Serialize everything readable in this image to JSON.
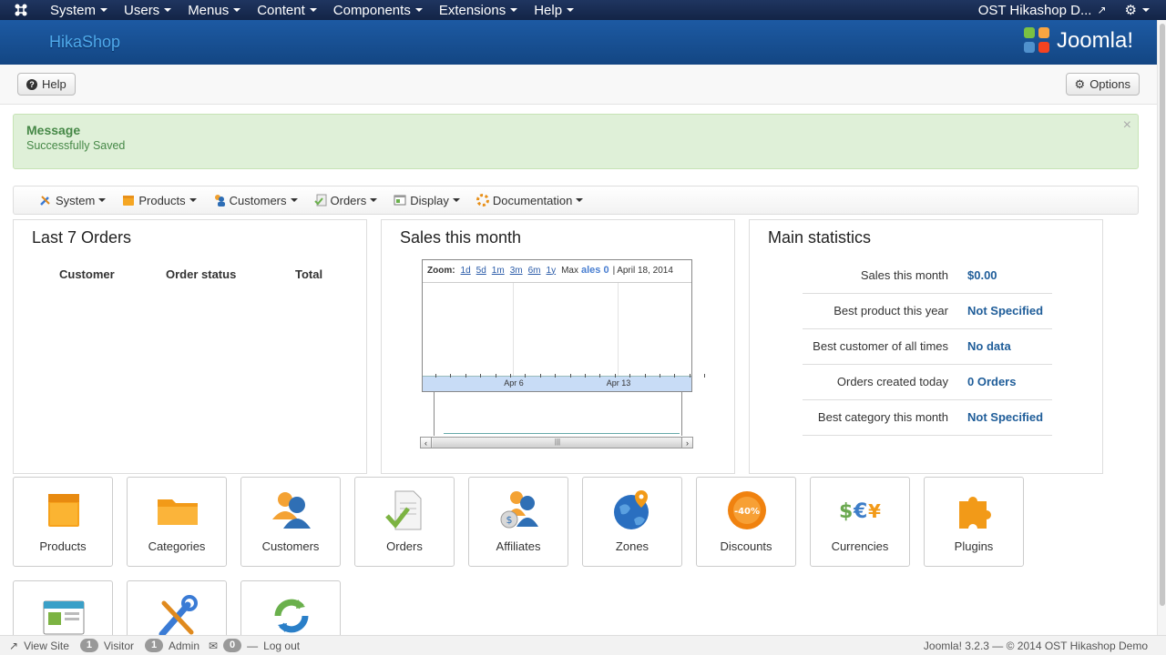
{
  "topbar": {
    "menu": [
      "System",
      "Users",
      "Menus",
      "Content",
      "Components",
      "Extensions",
      "Help"
    ],
    "site_name": "OST Hikashop D..."
  },
  "header": {
    "brand": "HikaShop",
    "cms": "Joomla!"
  },
  "toolbar": {
    "help_label": "Help",
    "options_label": "Options"
  },
  "message": {
    "title": "Message",
    "text": "Successfully Saved"
  },
  "submenu": [
    "System",
    "Products",
    "Customers",
    "Orders",
    "Display",
    "Documentation"
  ],
  "orders_panel": {
    "title": "Last 7 Orders",
    "columns": [
      "Customer",
      "Order status",
      "Total"
    ]
  },
  "sales_panel": {
    "title": "Sales this month",
    "zoom_label": "Zoom:",
    "zoom_options": [
      "1d",
      "5d",
      "1m",
      "3m",
      "6m",
      "1y"
    ],
    "max_label": "Max",
    "legend_fragment": "ales 0",
    "date_label": "April 18, 2014"
  },
  "chart_data": {
    "type": "line",
    "x_tick_labels": [
      "Apr 6",
      "Apr 13"
    ],
    "series": [
      {
        "values": [
          0
        ]
      }
    ],
    "legend": "ales 0",
    "grid": true
  },
  "stats_panel": {
    "title": "Main statistics",
    "rows": [
      {
        "label": "Sales this month",
        "value": "$0.00"
      },
      {
        "label": "Best product this year",
        "value": "Not Specified"
      },
      {
        "label": "Best customer of all times",
        "value": "No data"
      },
      {
        "label": "Orders created today",
        "value": "0 Orders"
      },
      {
        "label": "Best category this month",
        "value": "Not Specified"
      }
    ]
  },
  "tiles": [
    "Products",
    "Categories",
    "Customers",
    "Orders",
    "Affiliates",
    "Zones",
    "Discounts",
    "Currencies",
    "Plugins"
  ],
  "footer": {
    "view_site": "View Site",
    "visitor_count": "1",
    "visitor_label": "Visitor",
    "admin_count": "1",
    "admin_label": "Admin",
    "messages_count": "0",
    "logout": "Log out",
    "copyright": "Joomla! 3.2.3  —  © 2014 OST Hikashop Demo"
  },
  "colors": {
    "topbar": "#132446",
    "header": "#1d5aa3",
    "accent_link": "#1f5d99",
    "success_bg": "#dff0d8"
  }
}
